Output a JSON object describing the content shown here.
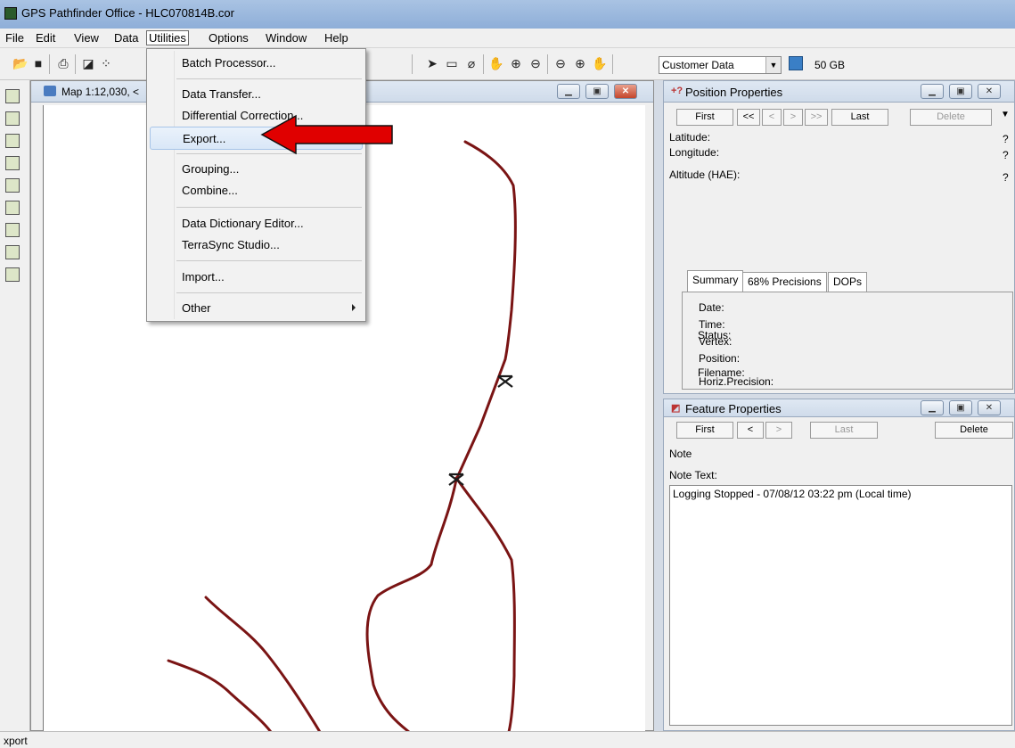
{
  "window": {
    "title": "GPS Pathfinder Office - HLC070814B.cor"
  },
  "menubar": [
    "File",
    "Edit",
    "View",
    "Data",
    "Utilities",
    "Options",
    "Window",
    "Help"
  ],
  "toolbar": {
    "layer_combo": "Customer Data",
    "disk_label": "50 GB"
  },
  "utilities_menu": {
    "items": [
      {
        "label": "Batch Processor..."
      },
      {
        "label": "Data Transfer..."
      },
      {
        "label": "Differential Correction..."
      },
      {
        "label": "Export...",
        "highlighted": true
      },
      {
        "label": "Grouping..."
      },
      {
        "label": "Combine..."
      },
      {
        "label": "Data Dictionary Editor..."
      },
      {
        "label": "TerraSync Studio..."
      },
      {
        "label": "Import..."
      },
      {
        "label": "Other",
        "submenu": true
      }
    ]
  },
  "map_window": {
    "title": "Map 1:12,030, <"
  },
  "position_properties": {
    "title": "Position Properties",
    "nav": {
      "first": "First",
      "prev_prev": "<<",
      "prev": "<",
      "next": ">",
      "next_next": ">>",
      "last": "Last",
      "delete": "Delete"
    },
    "fields": {
      "latitude": "Latitude:",
      "longitude": "Longitude:",
      "altitude": "Altitude (HAE):",
      "unknown": "?"
    },
    "tabs": [
      "Summary",
      "68% Precisions",
      "DOPs"
    ],
    "summary": [
      "Date:",
      "Time:",
      "Vertex:",
      "Position:",
      "Horiz.Precision:",
      "Status:",
      "Filename:"
    ]
  },
  "feature_properties": {
    "title": "Feature Properties",
    "nav": {
      "first": "First",
      "prev": "<",
      "next": ">",
      "last": "Last",
      "delete": "Delete"
    },
    "feature_name": "Note",
    "note_label": "Note Text:",
    "note_text": "Logging Stopped - 07/08/12 03:22 pm (Local time)"
  },
  "statusbar": {
    "text": "xport"
  },
  "colors": {
    "track": "#7a1414",
    "arrow": "#e00000",
    "menu_highlight": "#d9e7f7"
  }
}
